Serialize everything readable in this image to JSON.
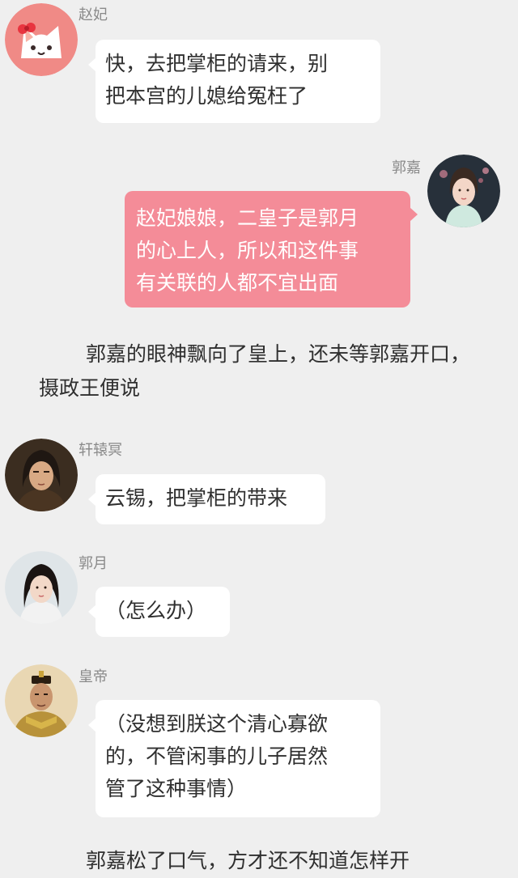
{
  "messages": [
    {
      "id": "zhao-fei",
      "sender": "赵妃",
      "avatar_icon": "cat-avatar-icon",
      "side": "left",
      "lines": [
        "快，去把掌柜的请来，别",
        "把本宫的儿媳给冤枉了"
      ]
    },
    {
      "id": "guo-jia",
      "sender": "郭嘉",
      "avatar_icon": "woman-portrait-avatar-icon",
      "side": "right",
      "lines": [
        "赵妃娘娘，二皇子是郭月",
        "的心上人，所以和这件事",
        "有关联的人都不宜出面"
      ]
    },
    {
      "id": "xuanyuan-ming",
      "sender": "轩辕冥",
      "avatar_icon": "man-portrait-avatar-icon",
      "side": "left",
      "lines": [
        "云锡，把掌柜的带来"
      ]
    },
    {
      "id": "guo-yue",
      "sender": "郭月",
      "avatar_icon": "woman-portrait-avatar-icon",
      "side": "left",
      "lines": [
        "（怎么办）"
      ]
    },
    {
      "id": "emperor",
      "sender": "皇帝",
      "avatar_icon": "emperor-portrait-avatar-icon",
      "side": "left",
      "lines": [
        "（没想到朕这个清心寡欲",
        "的，不管闲事的儿子居然",
        "管了这种事情）"
      ]
    }
  ],
  "narrations": [
    {
      "id": "narration-1",
      "lines": [
        "郭嘉的眼神飘向了皇上，还未等郭嘉",
        "开口，摄政王便说"
      ]
    },
    {
      "id": "narration-2",
      "lines": [
        "郭嘉松了口气，方才还不知道怎样开"
      ]
    }
  ],
  "colors": {
    "background": "#efefef",
    "bubble_white": "#ffffff",
    "bubble_pink": "#f48c98",
    "name_text": "#8a8a8a"
  }
}
